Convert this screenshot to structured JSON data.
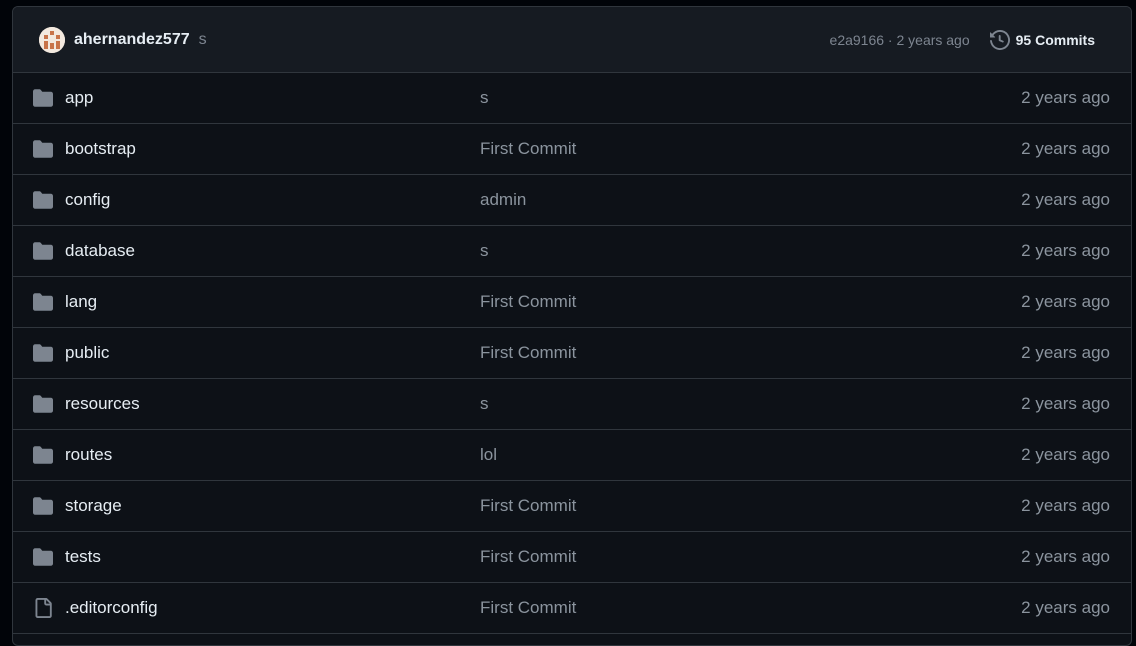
{
  "latest_commit": {
    "author": "ahernandez577",
    "message": "s",
    "meta": "e2a9166 · 2 years ago",
    "commits_label": "95 Commits"
  },
  "files": [
    {
      "name": "app",
      "type": "folder",
      "message": "s",
      "age": "2 years ago"
    },
    {
      "name": "bootstrap",
      "type": "folder",
      "message": "First Commit",
      "age": "2 years ago"
    },
    {
      "name": "config",
      "type": "folder",
      "message": "admin",
      "age": "2 years ago"
    },
    {
      "name": "database",
      "type": "folder",
      "message": "s",
      "age": "2 years ago"
    },
    {
      "name": "lang",
      "type": "folder",
      "message": "First Commit",
      "age": "2 years ago"
    },
    {
      "name": "public",
      "type": "folder",
      "message": "First Commit",
      "age": "2 years ago"
    },
    {
      "name": "resources",
      "type": "folder",
      "message": "s",
      "age": "2 years ago"
    },
    {
      "name": "routes",
      "type": "folder",
      "message": "lol",
      "age": "2 years ago"
    },
    {
      "name": "storage",
      "type": "folder",
      "message": "First Commit",
      "age": "2 years ago"
    },
    {
      "name": "tests",
      "type": "folder",
      "message": "First Commit",
      "age": "2 years ago"
    },
    {
      "name": ".editorconfig",
      "type": "file",
      "message": "First Commit",
      "age": "2 years ago"
    }
  ],
  "icons": {
    "folder": "folder-icon",
    "file": "file-icon",
    "history": "history-icon"
  },
  "colors": {
    "background": "#0d1117",
    "header": "#161b22",
    "border": "#30363d",
    "text": "#e6edf3",
    "muted": "#8b949e",
    "icon": "#7d8590"
  }
}
